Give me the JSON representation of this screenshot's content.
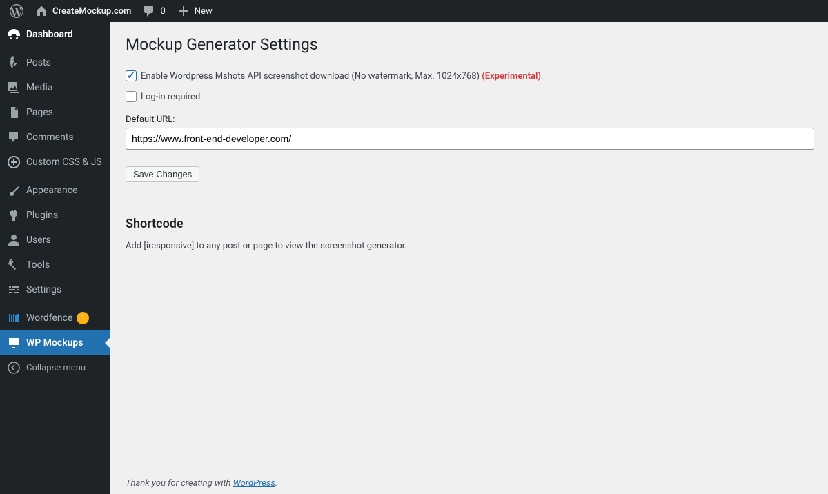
{
  "adminbar": {
    "site_name": "CreateMockup.com",
    "comments_count": "0",
    "new_label": "New"
  },
  "sidebar": {
    "items": [
      {
        "id": "dashboard",
        "label": "Dashboard"
      },
      {
        "id": "posts",
        "label": "Posts"
      },
      {
        "id": "media",
        "label": "Media"
      },
      {
        "id": "pages",
        "label": "Pages"
      },
      {
        "id": "comments",
        "label": "Comments"
      },
      {
        "id": "customcss",
        "label": "Custom CSS & JS"
      },
      {
        "id": "appearance",
        "label": "Appearance"
      },
      {
        "id": "plugins",
        "label": "Plugins"
      },
      {
        "id": "users",
        "label": "Users"
      },
      {
        "id": "tools",
        "label": "Tools"
      },
      {
        "id": "settings",
        "label": "Settings"
      },
      {
        "id": "wordfence",
        "label": "Wordfence",
        "badge": "1"
      },
      {
        "id": "wpmockups",
        "label": "WP Mockups"
      }
    ],
    "collapse_label": "Collapse menu"
  },
  "page": {
    "title": "Mockup Generator Settings",
    "enable_label": "Enable Wordpress Mshots API screenshot download (No watermark, Max. 1024x768) ",
    "enable_experimental": "(Experimental)",
    "enable_dot": ".",
    "enable_checked": true,
    "login_label": "Log-in required",
    "login_checked": false,
    "default_url_label": "Default URL:",
    "default_url_value": "https://www.front-end-developer.com/",
    "save_label": "Save Changes",
    "shortcode_heading": "Shortcode",
    "shortcode_desc": "Add [iresponsive] to any post or page to view the screenshot generator."
  },
  "footer": {
    "prefix": "Thank you for creating with ",
    "link": "WordPress",
    "suffix": "."
  }
}
